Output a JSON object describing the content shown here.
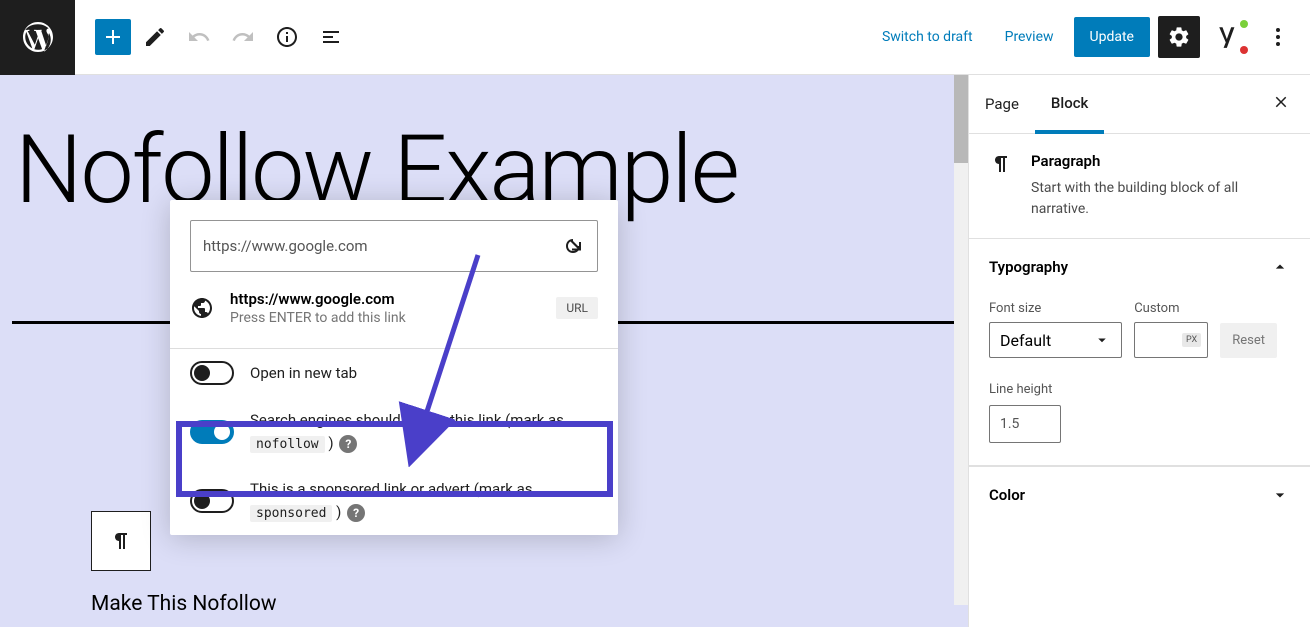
{
  "toolbar": {
    "switch_to_draft": "Switch to draft",
    "preview": "Preview",
    "update": "Update"
  },
  "canvas": {
    "post_title": "Nofollow Example",
    "paragraph_text": "Make This Nofollow"
  },
  "link_popover": {
    "input_value": "https://www.google.com",
    "suggestion_title": "https://www.google.com",
    "suggestion_sub": "Press ENTER to add this link",
    "url_badge": "URL",
    "toggle_new_tab": "Open in new tab",
    "toggle_nofollow_pre": "Search engines should ignore this link (mark as ",
    "toggle_nofollow_code": "nofollow",
    "toggle_nofollow_post": " )",
    "toggle_sponsored_pre": "This is a sponsored link or advert (mark as ",
    "toggle_sponsored_code": "sponsored",
    "toggle_sponsored_post": " )"
  },
  "sidebar": {
    "tab_page": "Page",
    "tab_block": "Block",
    "block_title": "Paragraph",
    "block_desc": "Start with the building block of all narrative.",
    "typography": {
      "title": "Typography",
      "font_size_label": "Font size",
      "font_size_value": "Default",
      "custom_label": "Custom",
      "px_unit": "PX",
      "reset": "Reset",
      "line_height_label": "Line height",
      "line_height_value": "1.5"
    },
    "color_title": "Color"
  }
}
